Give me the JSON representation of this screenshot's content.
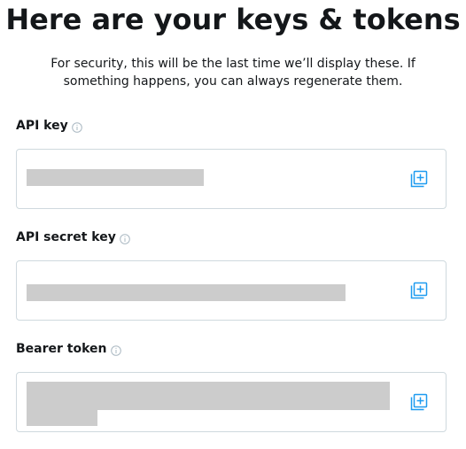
{
  "page": {
    "title": "Here are your keys & tokens",
    "subtitle": "For security, this will be the last time we’ll display these. If something happens, you can always regenerate them."
  },
  "fields": [
    {
      "label": "API key",
      "icon": "info-icon",
      "copy_icon": "copy-icon",
      "value_redacted": true
    },
    {
      "label": "API secret key",
      "icon": "info-icon",
      "copy_icon": "copy-icon",
      "value_redacted": true
    },
    {
      "label": "Bearer token",
      "icon": "info-icon",
      "copy_icon": "copy-icon",
      "value_redacted": true
    }
  ],
  "colors": {
    "accent": "#1d9bf0",
    "text": "#14171a",
    "border": "#cfd9de",
    "redaction": "#cccccc"
  }
}
